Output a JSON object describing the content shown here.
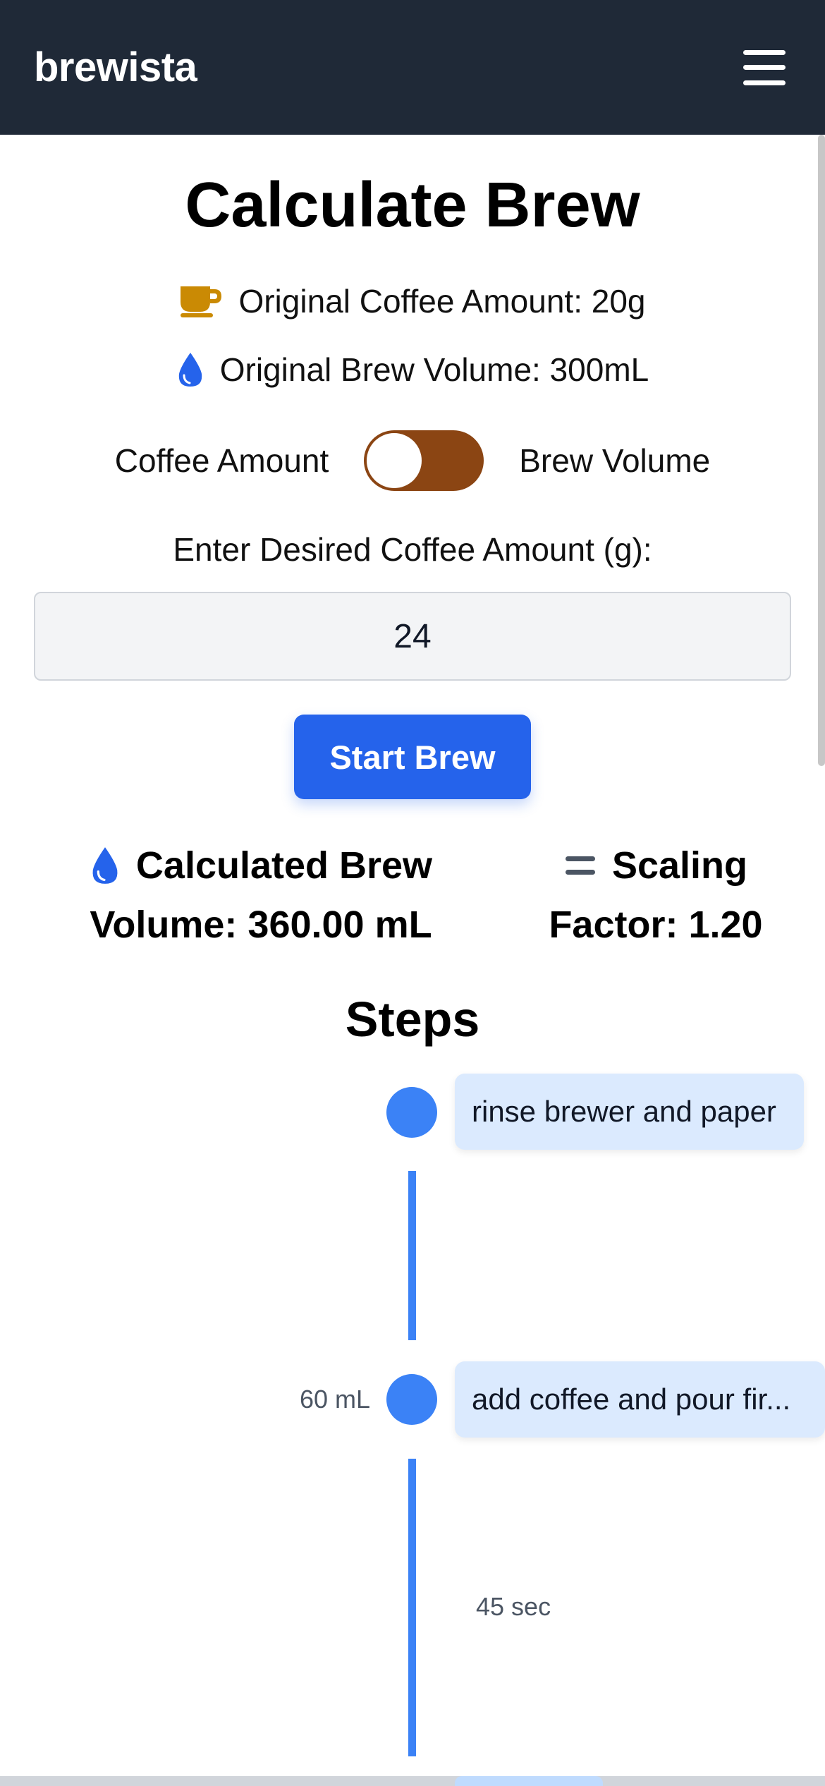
{
  "header": {
    "brand": "brewista",
    "menu_icon": "hamburger-menu-icon"
  },
  "page_title": "Calculate Brew",
  "original": {
    "coffee_label": "Original Coffee Amount: 20g",
    "coffee_icon": "coffee-cup-icon",
    "brew_label": "Original Brew Volume: 300mL",
    "brew_icon": "water-drop-icon"
  },
  "toggle": {
    "left_label": "Coffee Amount",
    "right_label": "Brew Volume",
    "selected": "Coffee Amount"
  },
  "input": {
    "label": "Enter Desired Coffee Amount (g):",
    "value": "24"
  },
  "start_button": "Start Brew",
  "results": {
    "volume_line1": "Calculated Brew",
    "volume_line2": "Volume: 360.00 mL",
    "factor_line1": "Scaling",
    "factor_line2": "Factor: 1.20"
  },
  "steps_title": "Steps",
  "steps": [
    {
      "text": "rinse brewer and paper",
      "water": ""
    },
    {
      "text": "add coffee and pour fir...",
      "water": "60 mL",
      "duration": "45 sec"
    }
  ],
  "colors": {
    "header_bg": "#1f2937",
    "accent": "#2563eb",
    "toggle": "#8b4513",
    "coffee_icon": "#ca8a04",
    "drop_icon": "#2563eb",
    "step_dot": "#3b82f6",
    "step_card": "#dbeafe"
  }
}
